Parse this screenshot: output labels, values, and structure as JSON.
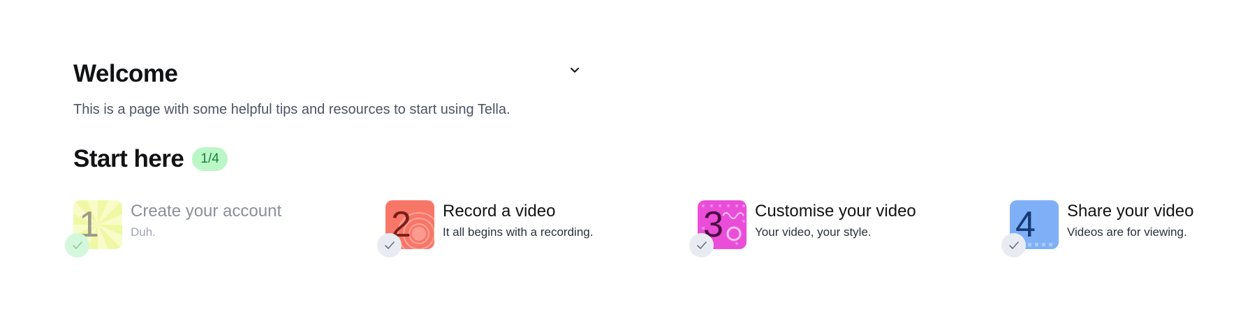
{
  "header": {
    "title": "Welcome",
    "subtitle": "This is a page with some helpful tips and resources to start using Tella.",
    "toggle_icon": "chevron-down-icon"
  },
  "start_section": {
    "title": "Start here",
    "progress": "1/4"
  },
  "steps": [
    {
      "number": "1",
      "title": "Create your account",
      "description": "Duh.",
      "completed": true,
      "color": "#eef79f"
    },
    {
      "number": "2",
      "title": "Record a video",
      "description": "It all begins with a recording.",
      "completed": false,
      "color": "#f87668"
    },
    {
      "number": "3",
      "title": "Customise your video",
      "description": "Your video, your style.",
      "completed": false,
      "color": "#ea4ed8"
    },
    {
      "number": "4",
      "title": "Share your video",
      "description": "Videos are for viewing.",
      "completed": false,
      "color": "#7fb0f7"
    }
  ],
  "colors": {
    "badge_bg": "#bbf7c6",
    "badge_text": "#15803d",
    "check_done_bg": "#d4f8dc",
    "check_pending_bg": "#e8ecf2"
  }
}
